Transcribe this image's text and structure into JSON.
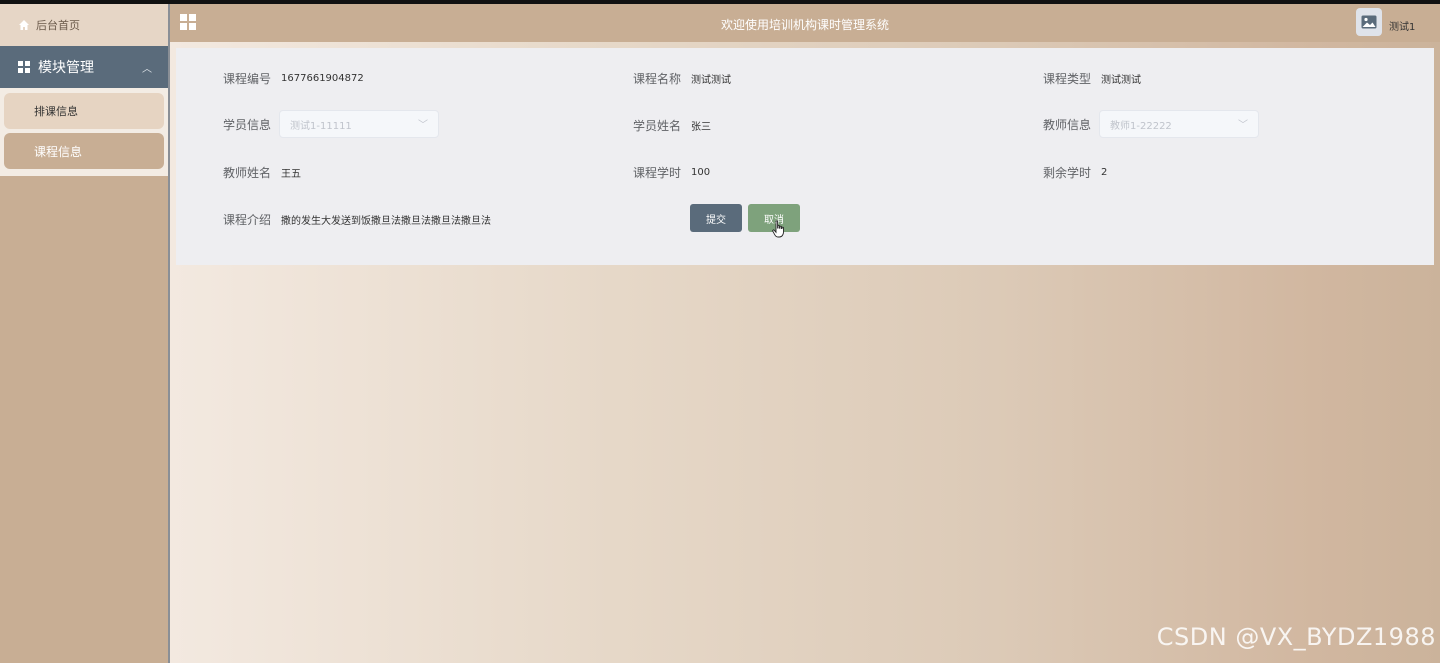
{
  "header": {
    "title": "欢迎使用培训机构课时管理系统",
    "username": "测试1"
  },
  "sidebar": {
    "home_label": "后台首页",
    "group_label": "模块管理",
    "items": [
      {
        "label": "排课信息"
      },
      {
        "label": "课程信息"
      }
    ]
  },
  "form": {
    "course_no": {
      "label": "课程编号",
      "value": "1677661904872"
    },
    "course_name": {
      "label": "课程名称",
      "value": "测试测试"
    },
    "course_type": {
      "label": "课程类型",
      "value": "测试测试"
    },
    "student_info": {
      "label": "学员信息",
      "value": "测试1-11111"
    },
    "student_name": {
      "label": "学员姓名",
      "value": "张三"
    },
    "teacher_info": {
      "label": "教师信息",
      "value": "教师1-22222"
    },
    "teacher_name": {
      "label": "教师姓名",
      "value": "王五"
    },
    "course_hours": {
      "label": "课程学时",
      "value": "100"
    },
    "remaining_hours": {
      "label": "剩余学时",
      "value": "2"
    },
    "course_intro": {
      "label": "课程介绍",
      "value": "撒的发生大发送到饭撒旦法撒旦法撒旦法撒旦法"
    },
    "submit_label": "提交",
    "cancel_label": "取消"
  },
  "watermark": "CSDN @VX_BYDZ1988",
  "colors": {
    "sidebar_bg": "#c8ae94",
    "group_bg": "#5a6b7b",
    "submit_bg": "#5a6b7b",
    "cancel_bg": "#7ea27c"
  }
}
